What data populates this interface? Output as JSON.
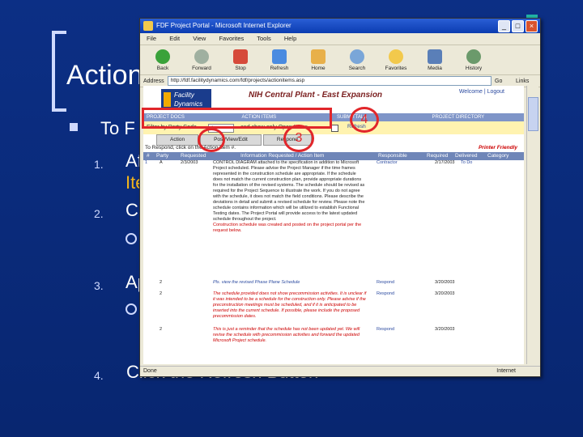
{
  "slide": {
    "title": "Action",
    "lvl1_prefix": "To F",
    "steps": [
      {
        "num": "1.",
        "text_a": "Af",
        "text_b": "Ite"
      },
      {
        "num": "2.",
        "text": "Cl"
      },
      {
        "num": "3.",
        "text": "Ap"
      },
      {
        "num": "4.",
        "text": "Click the Refresh Button"
      }
    ],
    "colors": {
      "background": "#0a2a78",
      "accent": "#f3b51b",
      "teal": "#21b3a5",
      "annotation": "#e1262a"
    }
  },
  "browser": {
    "title": "FDF Project Portal - Microsoft Internet Explorer",
    "menu": [
      "File",
      "Edit",
      "View",
      "Favorites",
      "Tools",
      "Help"
    ],
    "toolbar": [
      {
        "label": "Back",
        "icon": "back-arrow-icon"
      },
      {
        "label": "Forward",
        "icon": "forward-arrow-icon"
      },
      {
        "label": "Stop",
        "icon": "stop-icon"
      },
      {
        "label": "Refresh",
        "icon": "refresh-icon"
      },
      {
        "label": "Home",
        "icon": "home-icon"
      },
      {
        "label": "Search",
        "icon": "search-icon"
      },
      {
        "label": "Favorites",
        "icon": "star-icon"
      },
      {
        "label": "Media",
        "icon": "media-icon"
      },
      {
        "label": "History",
        "icon": "history-icon"
      }
    ],
    "address_label": "Address",
    "address_value": "http://fdf.facilitydynamics.com/fdf/projects/actionitems.asp",
    "go": "Go",
    "links": "Links",
    "status_left": "Done",
    "status_zone": "Internet"
  },
  "portal": {
    "logo": "Facility Dynamics",
    "project": "NIH Central Plant - East Expansion",
    "nav_right": "Welcome | Logout",
    "navstrip": [
      "PROJECT DOCS",
      "ACTION ITEMS",
      "SUBMITTALS",
      "PROJECT DIRECTORY"
    ],
    "filter_label": "Filter by Party Code",
    "filter_value": "A",
    "filter_and": "and show only Open Items",
    "refresh": "Refresh",
    "tabs": [
      "Action",
      "Post/View/Edit",
      "Respond"
    ],
    "hint": "To Respond, click on the Action Item #.",
    "printer": "Printer Friendly",
    "headers": [
      "#",
      "Party",
      "Requested",
      "Information Requested / Action Item",
      "Responsible",
      "Required",
      "Delivered",
      "Category"
    ],
    "row1": {
      "num": "1",
      "party": "A",
      "requested": "2/3/2003",
      "text": "CONTROL DIAGRAM attached to the specification in addition to Microsoft Project scheduled. Please advise the Project Manager if the time frames represented in the construction schedule are appropriate. If the schedule does not match the current construction plan, provide appropriate durations for the installation of the revised systems. The schedule should be revised as required for the Project Sequence to illustrate the work. If you do not agree with the schedule, it does not match the field conditions. Please describe the deviations in detail and submit a revised schedule for review. Please note the schedule contains information which will be utilized to establish Functional Testing dates. The Project Portal will provide access to the latest updated schedule throughout the project.",
      "red_note": "Construction schedule was created and posted on the project portal per the request below.",
      "responsible": "Contractor",
      "required": "2/17/2003",
      "delivered": "To Do"
    },
    "rows": [
      {
        "num": "2",
        "text": "Pls. view the revised Phase Plane Schedule",
        "resp": "Respond",
        "date": "3/20/2003",
        "style": "blue"
      },
      {
        "num": "2",
        "text": "The schedule provided does not show precommission activities. It is unclear if it was intended to be a schedule for the construction only. Please advise if the preconstruction meetings must be scheduled, and if it is anticipated to be inserted into the current schedule. If possible, please include the proposed precommission dates.",
        "resp": "Respond",
        "date": "3/20/2003",
        "style": "red"
      },
      {
        "num": "2",
        "text": "This is just a reminder that the schedule has not been updated yet. We will revise the schedule with precommission activities and forward the updated Microsoft Project schedule.",
        "resp": "Respond",
        "date": "3/20/2003",
        "style": "red"
      }
    ]
  },
  "annotations": [
    "3",
    "4"
  ]
}
